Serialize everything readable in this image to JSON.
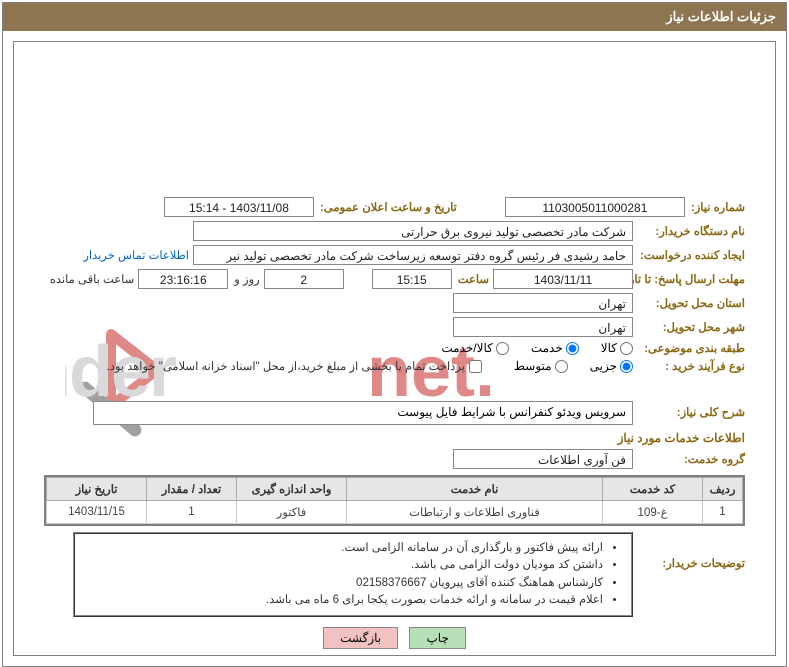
{
  "header": {
    "title": "جزئیات اطلاعات نیاز"
  },
  "need_number": {
    "label": "شماره نیاز:",
    "value": "1103005011000281"
  },
  "announce": {
    "label": "تاریخ و ساعت اعلان عمومی:",
    "value": "1403/11/08 - 15:14"
  },
  "buyer": {
    "label": "نام دستگاه خریدار:",
    "value": "شرکت مادر تخصصی تولید نیروی برق حرارتی"
  },
  "creator": {
    "label": "ایجاد کننده درخواست:",
    "value": "حامد رشیدی فر رئیس گروه دفتر توسعه زیرساخت شرکت مادر تخصصی تولید نیر",
    "link": "اطلاعات تماس خریدار"
  },
  "deadline": {
    "label": "مهلت ارسال پاسخ: تا تاریخ:",
    "date": "1403/11/11",
    "time_label": "ساعت",
    "time": "15:15",
    "days": "2",
    "days_label": "روز و",
    "remain": "23:16:16",
    "remain_label": "ساعت باقی مانده"
  },
  "province": {
    "label": "استان محل تحویل:",
    "value": "تهران"
  },
  "city": {
    "label": "شهر محل تحویل:",
    "value": "تهران"
  },
  "subject_group": {
    "label": "طبقه بندی موضوعی:",
    "kala": "کالا",
    "khedmat": "خدمت",
    "both": "کالا/خدمت"
  },
  "buy_type": {
    "label": "نوع فرآیند خرید :",
    "partial": "جزیی",
    "medium": "متوسط"
  },
  "pay_note": "پرداخت تمام یا بخشی از مبلغ خرید،از محل \"اسناد خزانه اسلامی\" خواهد بود.",
  "overall": {
    "label": "شرح کلی نیاز:",
    "value": "سرویس ویدئو کنفرانس با شرایط فایل پیوست"
  },
  "svc_info_heading": "اطلاعات خدمات مورد نیاز",
  "svc_group": {
    "label": "گروه خدمت:",
    "value": "فن آوری اطلاعات"
  },
  "table": {
    "headers": {
      "row": "ردیف",
      "code": "کد خدمت",
      "name": "نام خدمت",
      "unit": "واحد اندازه گیری",
      "qty": "تعداد / مقدار",
      "date": "تاریخ نیاز"
    },
    "rows": [
      {
        "row": "1",
        "code": "غ-109",
        "name": "فناوری اطلاعات و ارتباطات",
        "unit": "فاکتور",
        "qty": "1",
        "date": "1403/11/15"
      }
    ]
  },
  "buyer_notes": {
    "label": "توضیحات خریدار:",
    "items": [
      "ارائه پیش فاکتور و بارگذاری آن در سامانه الزامی است.",
      "داشتن کد مودیان دولت الزامی می باشد.",
      "کارشناس هماهنگ کننده آقای پیرویان 02158376667",
      "اعلام قیمت در سامانه و ارائه خدمات بصورت یکجا برای 6 ماه می باشد."
    ]
  },
  "buttons": {
    "print": "چاپ",
    "back": "بازگشت"
  }
}
